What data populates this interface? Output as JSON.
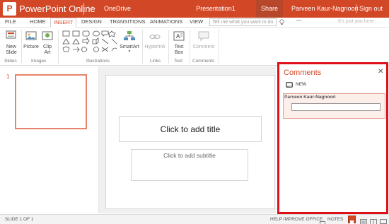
{
  "app_bar": {
    "logo_letter": "P",
    "app_name": "PowerPoint Online",
    "chevron": "⌵",
    "location": "OneDrive",
    "doc_name": "Presentation1",
    "share_label": "Share",
    "user_name": "Parveen Kaur-Nagnoori",
    "sign_out_label": "Sign out",
    "brand_color": "#d24726"
  },
  "tabs": [
    {
      "label": "FILE"
    },
    {
      "label": "HOME"
    },
    {
      "label": "INSERT",
      "active": true
    },
    {
      "label": "DESIGN"
    },
    {
      "label": "TRANSITIONS"
    },
    {
      "label": "ANIMATIONS"
    },
    {
      "label": "VIEW"
    }
  ],
  "tell_me": {
    "placeholder": "Tell me what you want to do"
  },
  "guest_text": "It's just you here",
  "ribbon": {
    "groups": [
      {
        "label": "Slides",
        "buttons": [
          {
            "label": "New Slide",
            "icon": "new-slide-icon"
          }
        ]
      },
      {
        "label": "Images",
        "buttons": [
          {
            "label": "Picture",
            "icon": "picture-icon"
          },
          {
            "label": "Clip Art",
            "icon": "clip-art-icon"
          }
        ]
      },
      {
        "label": "Illustrations",
        "buttons": [
          {
            "label": "SmartArt",
            "icon": "smartart-icon"
          }
        ]
      },
      {
        "label": "Links",
        "buttons": [
          {
            "label": "Hyperlink",
            "icon": "hyperlink-icon",
            "disabled": true
          }
        ]
      },
      {
        "label": "Text",
        "buttons": [
          {
            "label": "Text Box",
            "icon": "text-box-icon"
          }
        ]
      },
      {
        "label": "Comments",
        "buttons": [
          {
            "label": "Comment",
            "icon": "comment-icon",
            "disabled": true
          }
        ]
      }
    ]
  },
  "thumbnails": {
    "slides": [
      {
        "number": "1"
      }
    ]
  },
  "slide": {
    "title_placeholder": "Click to add title",
    "subtitle_placeholder": "Click to add subtitle"
  },
  "comments_pane": {
    "title": "Comments",
    "close_icon": "✕",
    "new_label": "NEW",
    "comment": {
      "author": "Parveen Kaur-Nagnoori",
      "input_value": ""
    },
    "highlight_color": "#e0101a"
  },
  "status_bar": {
    "slide_position": "SLIDE 1 OF 1",
    "help_label": "HELP IMPROVE OFFICE",
    "notes_label": "NOTES"
  }
}
